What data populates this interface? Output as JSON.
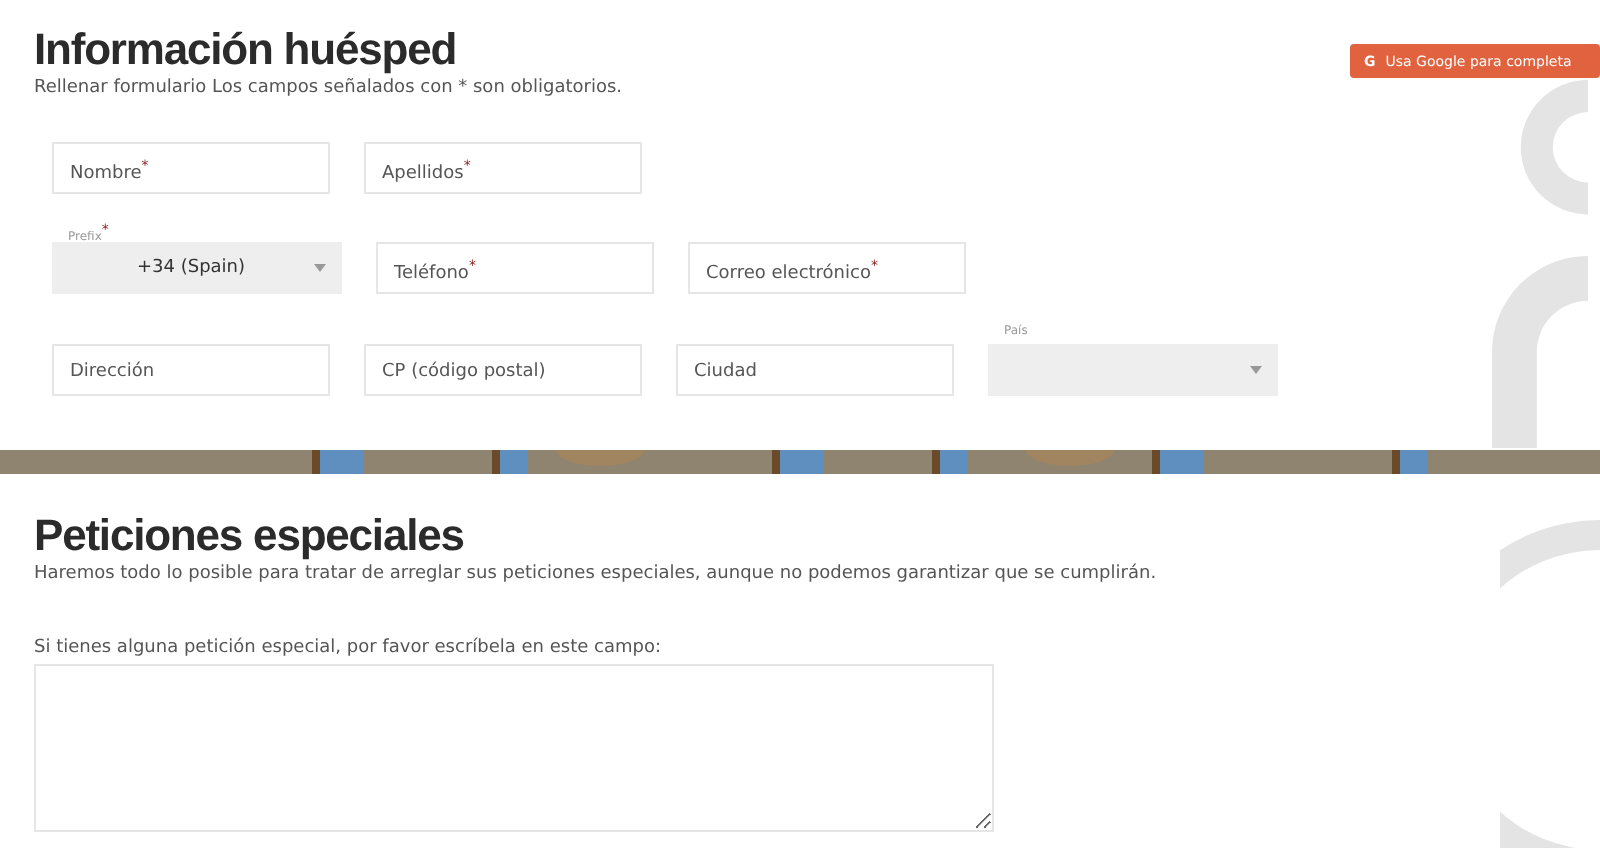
{
  "guest_section": {
    "title": "Información huésped",
    "subtitle": "Rellenar formulario Los campos señalados con * son obligatorios.",
    "google_button": {
      "icon": "G",
      "label": "Usa Google para completa"
    },
    "rows": [
      [
        {
          "kind": "text",
          "placeholder": "Nombre$^{*}$"
        },
        {
          "kind": "text",
          "placeholder": "Apellidos$^{*}$"
        }
      ],
      [
        {
          "kind": "select",
          "label": "Prefix$^{*}$",
          "value": "+34 (Spain)"
        },
        {
          "kind": "text",
          "placeholder": "Teléfono$^{*}$"
        },
        {
          "kind": "text",
          "placeholder": "Correo electrónico$^{*}$"
        }
      ],
      [
        {
          "kind": "text",
          "placeholder": "Dirección"
        },
        {
          "kind": "text",
          "placeholder": "CP (código postal)"
        },
        {
          "kind": "text",
          "placeholder": "Ciudad"
        },
        {
          "kind": "select",
          "label": "País"
        }
      ]
    ]
  },
  "requests_section": {
    "title": "Peticiones especiales",
    "subtitle": "Haremos todo lo posible para tratar de arreglar sus peticiones especiales, aunque no podemos garantizar que se cumplirán.",
    "prompt": "Si tienes alguna petición especial, por favor escríbela en este campo:"
  }
}
